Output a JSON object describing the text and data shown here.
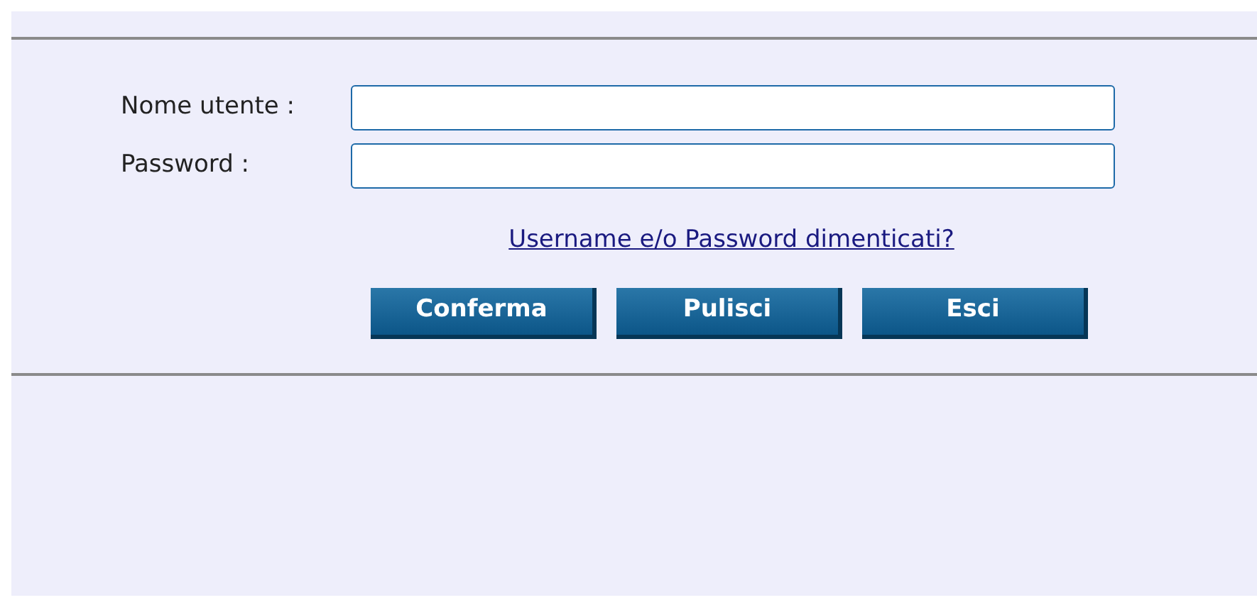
{
  "fields": [
    {
      "label": "Nome utente :"
    },
    {
      "label": "Password :"
    }
  ],
  "link": "Username e/o Password dimenticati?",
  "buttons": [
    "Conferma",
    "Pulisci",
    "Esci"
  ]
}
